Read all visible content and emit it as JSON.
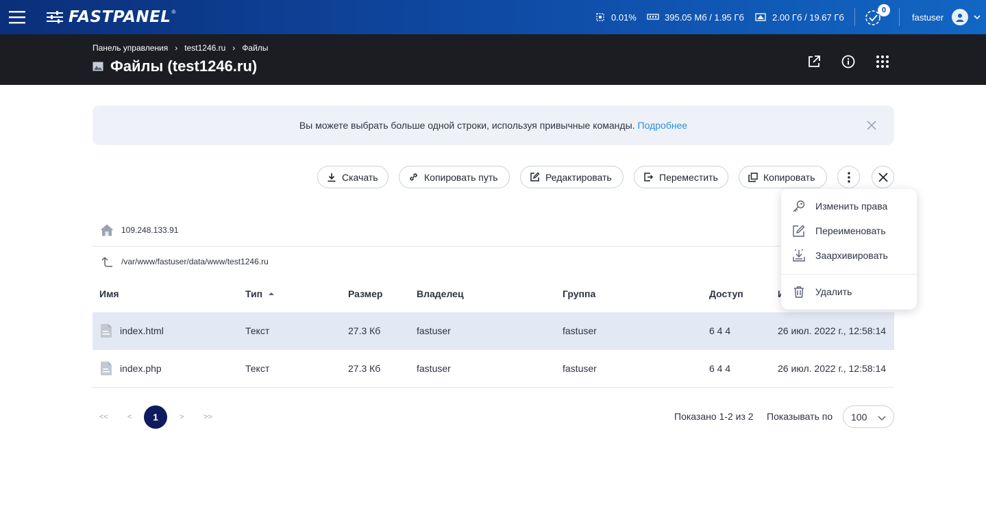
{
  "topbar": {
    "logo_text": "FASTPANEL",
    "logo_reg": "®",
    "cpu": "0.01%",
    "ram": "395.05 Мб / 1.95 Гб",
    "disk": "2.00 Гб / 19.67 Гб",
    "notifications_count": "0",
    "username": "fastuser"
  },
  "header": {
    "breadcrumbs": [
      "Панель управления",
      "test1246.ru",
      "Файлы"
    ],
    "title": "Файлы (test1246.ru)"
  },
  "banner": {
    "text": "Вы можете выбрать больше одной строки, используя привычные команды.",
    "link": "Подробнее"
  },
  "toolbar": {
    "download": "Скачать",
    "copy_path": "Копировать путь",
    "edit": "Редактировать",
    "move": "Переместить",
    "copy": "Копировать"
  },
  "browser": {
    "host": "109.248.133.91",
    "path": "/var/www/fastuser/data/www/test1246.ru"
  },
  "table": {
    "columns": [
      "Имя",
      "Тип",
      "Размер",
      "Владелец",
      "Группа",
      "Доступ",
      "И"
    ],
    "rows": [
      {
        "name": "index.html",
        "type": "Текст",
        "size": "27.3 Кб",
        "owner": "fastuser",
        "group": "fastuser",
        "access": "6 4 4",
        "modified": "26 июл. 2022 г., 12:58:14"
      },
      {
        "name": "index.php",
        "type": "Текст",
        "size": "27.3 Кб",
        "owner": "fastuser",
        "group": "fastuser",
        "access": "6 4 4",
        "modified": "26 июл. 2022 г., 12:58:14"
      }
    ]
  },
  "pagination": {
    "first": "<<",
    "prev": "<",
    "current": "1",
    "next": ">",
    "last": ">>",
    "shown": "Показано 1-2 из 2",
    "per_page_label": "Показывать по",
    "per_page_value": "100"
  },
  "menu": {
    "items": [
      "Изменить права",
      "Переименовать",
      "Заархивировать",
      "Удалить"
    ]
  }
}
